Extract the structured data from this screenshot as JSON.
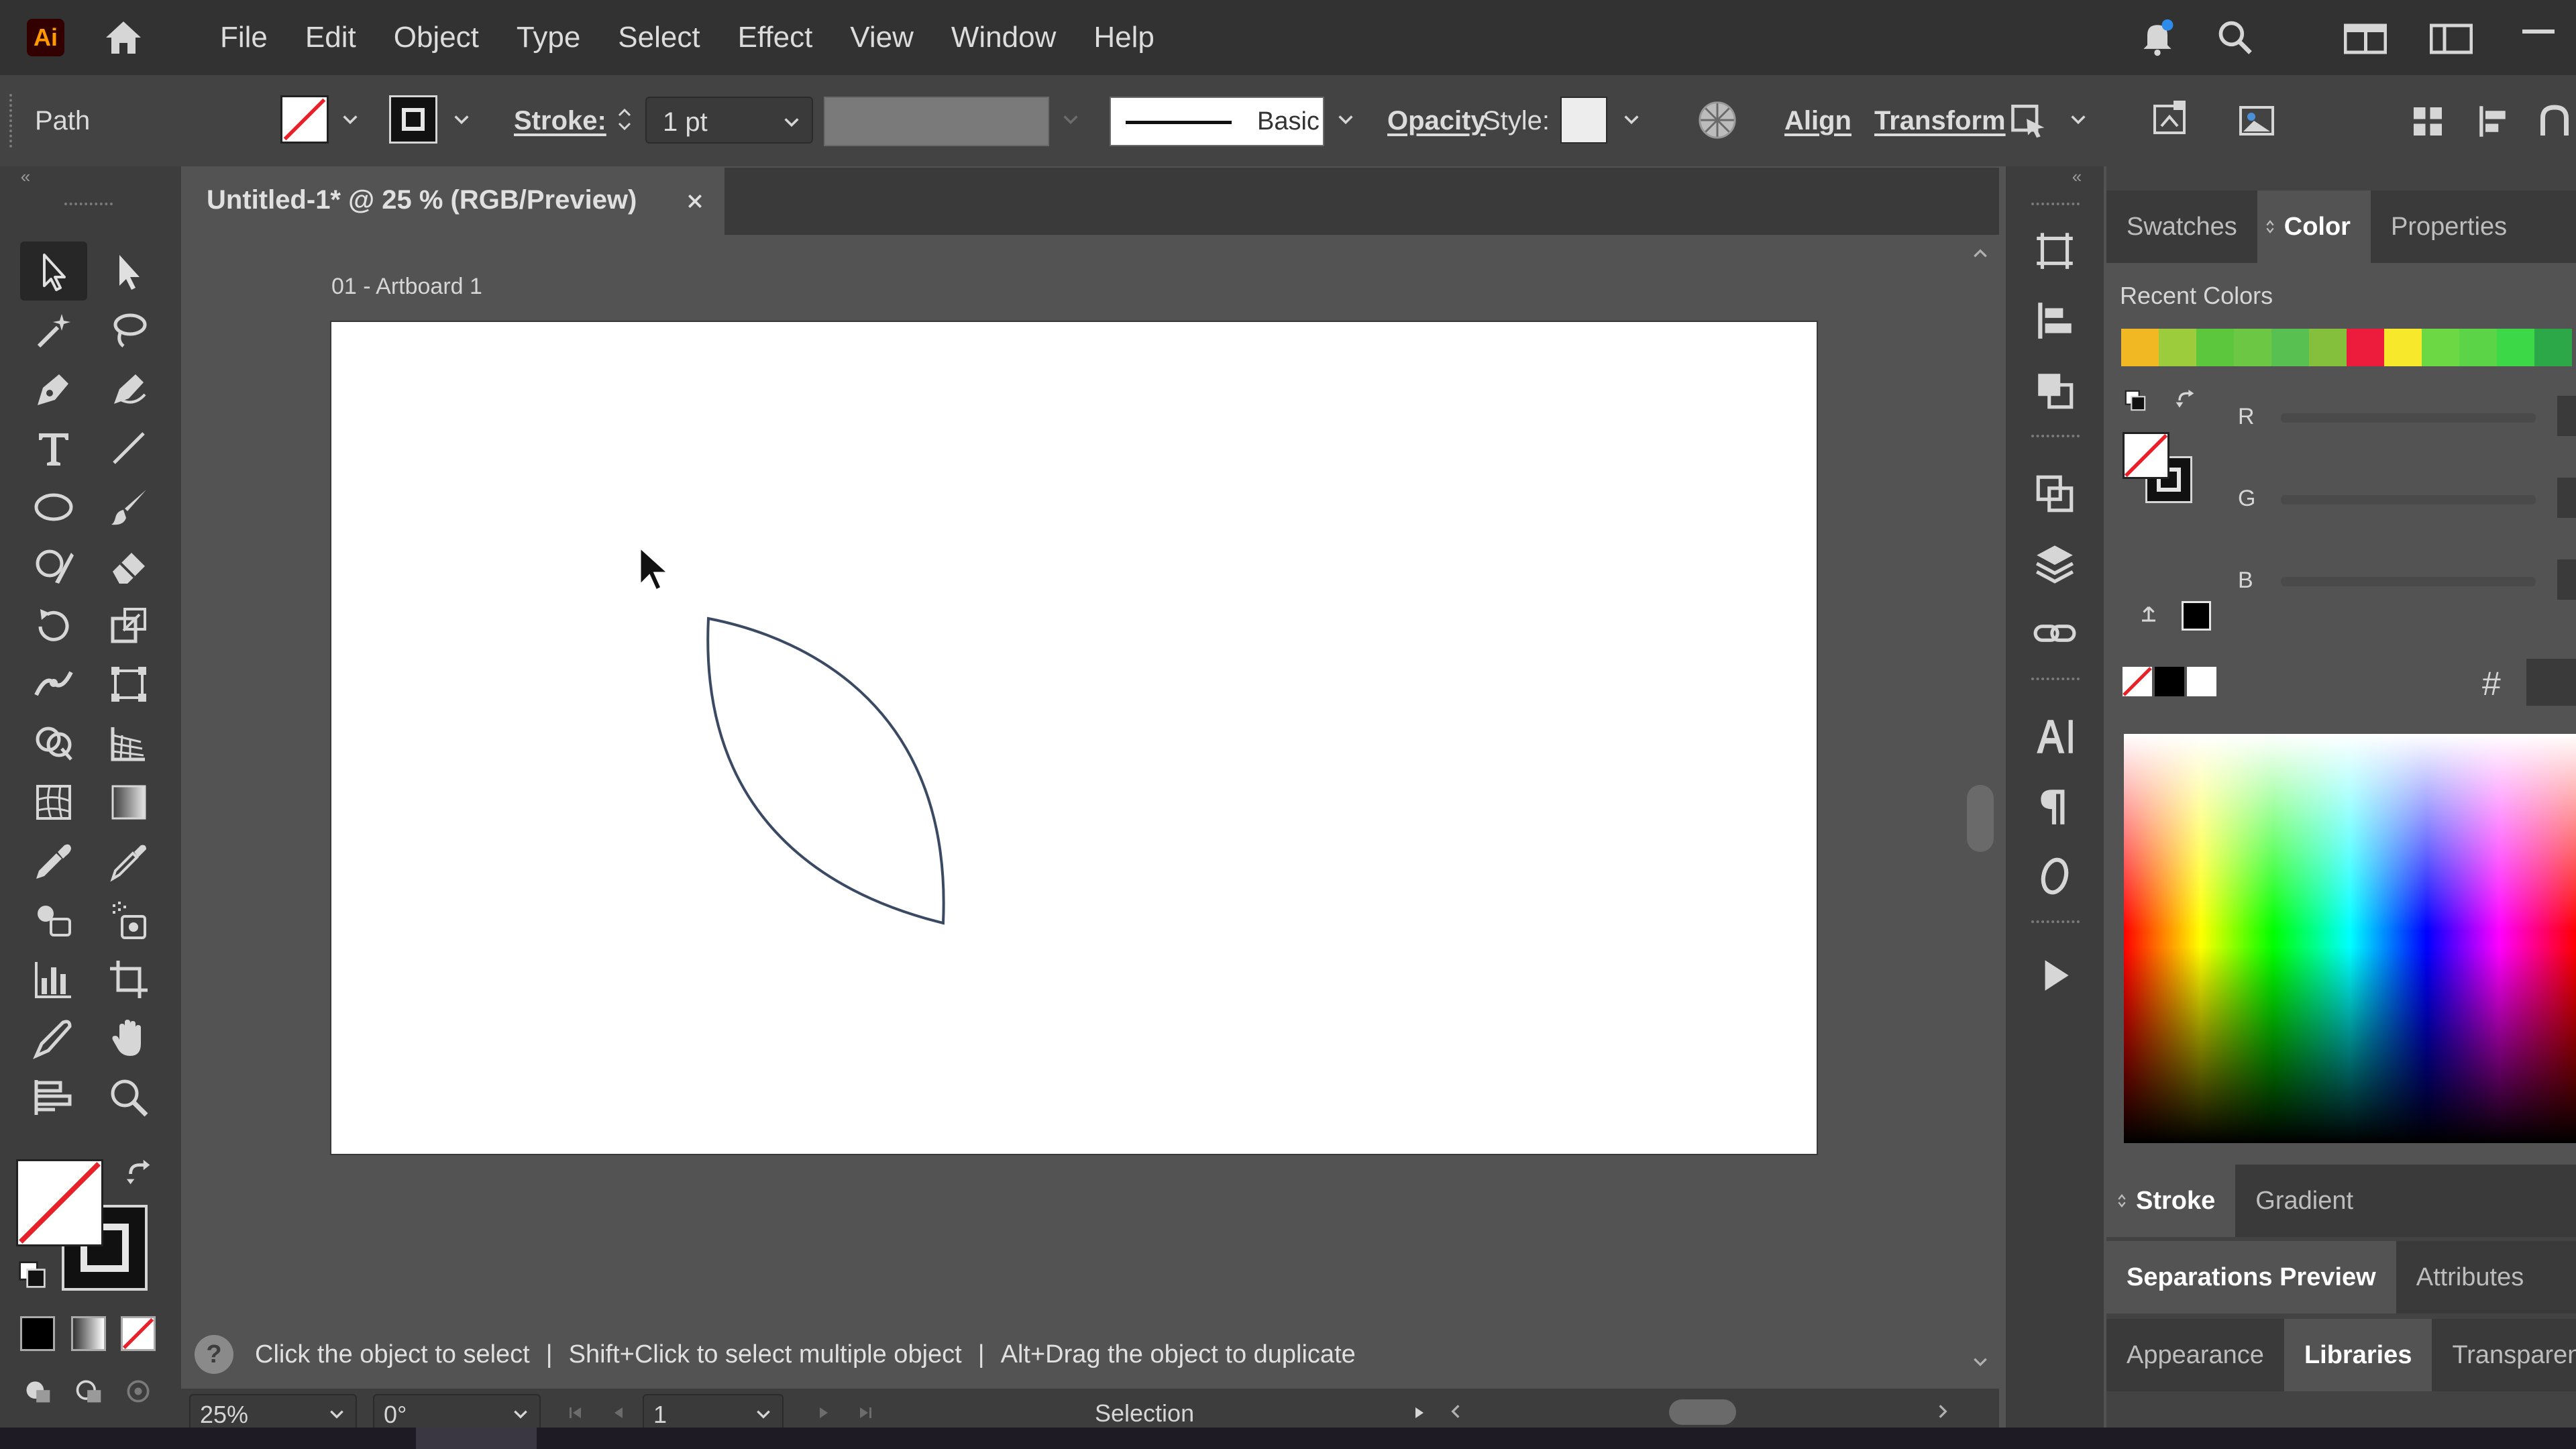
{
  "app": {
    "logo": "Ai"
  },
  "menu": [
    "File",
    "Edit",
    "Object",
    "Type",
    "Select",
    "Effect",
    "View",
    "Window",
    "Help"
  ],
  "control_bar": {
    "selection_type": "Path",
    "stroke_label": "Stroke:",
    "stroke_weight": "1 pt",
    "brush_name": "Basic",
    "opacity_label": "Opacity",
    "style_label": "Style:",
    "align_label": "Align",
    "transform_label": "Transform"
  },
  "document": {
    "tab_title": "Untitled-1* @ 25 % (RGB/Preview)",
    "artboard_label": "01 - Artboard 1",
    "stroke_color": "#3b4a63"
  },
  "status": {
    "hint_1": "Click the object to select",
    "hint_2": "Shift+Click to select multiple object",
    "hint_3": "Alt+Drag the object to duplicate",
    "separator": "|",
    "zoom": "25%",
    "rotation": "0°",
    "artboard_number": "1",
    "current_tool": "Selection"
  },
  "panel": {
    "top_tabs": [
      "Swatches",
      "Color",
      "Properties"
    ],
    "active_top_tab": "Color",
    "recent_colors_label": "Recent Colors",
    "recent_colors": [
      "#f2b824",
      "#9ccc3c",
      "#5cc63c",
      "#6cc844",
      "#58c050",
      "#84c03c",
      "#ee1c3c",
      "#f8e82c",
      "#6cd844",
      "#5cd448",
      "#3cd848",
      "#2ca848"
    ],
    "channels": [
      "R",
      "G",
      "B"
    ],
    "hex_symbol": "#",
    "stroke_tabs": [
      "Stroke",
      "Gradient"
    ],
    "bottom_tabs_1": [
      "Separations Preview",
      "Attributes"
    ],
    "bottom_tabs_2": [
      "Appearance",
      "Libraries",
      "Transparency"
    ]
  },
  "colors": {
    "accent_red": "#e8202a",
    "ui_dark": "#323232",
    "ui_panel": "#434343"
  }
}
